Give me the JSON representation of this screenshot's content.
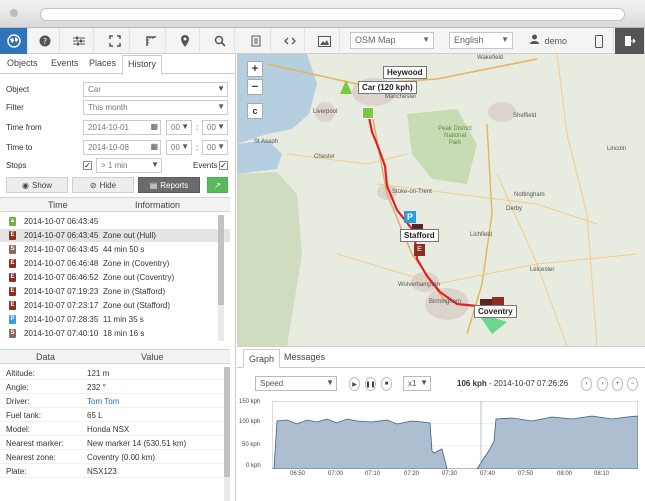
{
  "toolbar": {
    "map_type": "OSM Map",
    "language": "English",
    "user": "demo"
  },
  "left": {
    "tabs": [
      "Objects",
      "Events",
      "Places",
      "History"
    ],
    "active_tab": "History",
    "form": {
      "object_label": "Object",
      "object_value": "Car",
      "filter_label": "Filter",
      "filter_value": "This month",
      "time_from_label": "Time from",
      "time_from_date": "2014-10-01",
      "time_from_hour": "00",
      "time_from_min": "00",
      "time_to_label": "Time to",
      "time_to_date": "2014-10-08",
      "time_to_hour": "00",
      "time_to_min": "00",
      "stops_label": "Stops",
      "stops_value": "> 1 min",
      "events_label": "Events"
    },
    "buttons": {
      "show": "Show",
      "hide": "Hide",
      "reports": "Reports"
    },
    "events_table": {
      "headers": [
        "Time",
        "Information"
      ],
      "rows": [
        {
          "time": "2014-10-07 06:43:45",
          "info": "",
          "icon": "flag-green"
        },
        {
          "time": "2014-10-07 06:43:45",
          "info": "Zone out (Hull)",
          "icon": "event-red"
        },
        {
          "time": "2014-10-07 06:43:45",
          "info": "44 min 50 s",
          "icon": "stop-car"
        },
        {
          "time": "2014-10-07 06:46:48",
          "info": "Zone in (Coventry)",
          "icon": "event-red"
        },
        {
          "time": "2014-10-07 06:46:52",
          "info": "Zone out (Coventry)",
          "icon": "event-red"
        },
        {
          "time": "2014-10-07 07:19:23",
          "info": "Zone in (Stafford)",
          "icon": "event-red"
        },
        {
          "time": "2014-10-07 07:23:17",
          "info": "Zone out (Stafford)",
          "icon": "event-red"
        },
        {
          "time": "2014-10-07 07:28:35",
          "info": "11 min 35 s",
          "icon": "parking-blue"
        },
        {
          "time": "2014-10-07 07:40:10",
          "info": "18 min 16 s",
          "icon": "stop-car"
        }
      ]
    },
    "data_table": {
      "headers": [
        "Data",
        "Value"
      ],
      "rows": [
        {
          "k": "Altitude:",
          "v": "121 m"
        },
        {
          "k": "Angle:",
          "v": "232 °"
        },
        {
          "k": "Driver:",
          "v": "Tom Tom",
          "link": true
        },
        {
          "k": "Fuel tank:",
          "v": "65 L"
        },
        {
          "k": "Model:",
          "v": "Honda NSX"
        },
        {
          "k": "Nearest marker:",
          "v": "New marker 14 (530.51 km)"
        },
        {
          "k": "Nearest zone:",
          "v": "Coventry (0.00 km)"
        },
        {
          "k": "Plate:",
          "v": "NSX123"
        }
      ]
    }
  },
  "map": {
    "controls": [
      "+",
      "−",
      "c"
    ],
    "labels": {
      "heywood": "Heywood",
      "car": "Car (120 kph)",
      "stafford": "Stafford",
      "coventry": "Coventry"
    },
    "places": [
      "Wakefield",
      "Liverpool",
      "Manchester",
      "Sheffield",
      "St Asaph",
      "Chester",
      "Peak District National Park",
      "Lincoln",
      "Stoke-on-Trent",
      "Derby",
      "Nottingham",
      "Lichfield",
      "Leicester",
      "Wolverhampton",
      "Birmingham"
    ]
  },
  "graph": {
    "tabs": [
      "Graph",
      "Messages"
    ],
    "active_tab": "Graph",
    "series_select": "Speed",
    "speed_multiplier": "x1",
    "status_value": "106 kph",
    "status_time": " - 2014-10-07 07:26:26",
    "y_ticks": [
      "150 kph",
      "100 kph",
      "50 kph",
      "0 kph"
    ],
    "x_ticks": [
      "06:50",
      "07:00",
      "07:10",
      "07:20",
      "07:30",
      "07:40",
      "07:50",
      "08:00",
      "08:10"
    ],
    "accent_color": "#aebed1",
    "line_color": "#3a5f86"
  }
}
